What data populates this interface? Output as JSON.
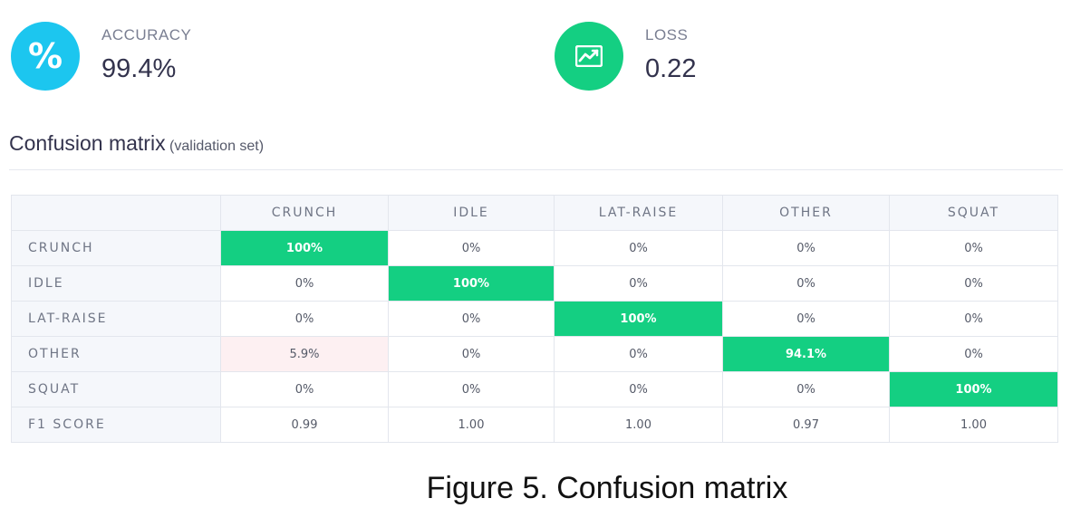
{
  "metrics": {
    "accuracy": {
      "label": "ACCURACY",
      "value": "99.4%",
      "icon": "percent-icon",
      "color": "#1cc6ef"
    },
    "loss": {
      "label": "LOSS",
      "value": "0.22",
      "icon": "chart-trend-icon",
      "color": "#14cf82"
    }
  },
  "confusion": {
    "title": "Confusion matrix",
    "subtitle": "(validation set)",
    "columns": [
      "CRUNCH",
      "IDLE",
      "LAT-RAISE",
      "OTHER",
      "SQUAT"
    ],
    "rows": [
      {
        "label": "CRUNCH",
        "cells": [
          "100%",
          "0%",
          "0%",
          "0%",
          "0%"
        ]
      },
      {
        "label": "IDLE",
        "cells": [
          "0%",
          "100%",
          "0%",
          "0%",
          "0%"
        ]
      },
      {
        "label": "LAT-RAISE",
        "cells": [
          "0%",
          "0%",
          "100%",
          "0%",
          "0%"
        ]
      },
      {
        "label": "OTHER",
        "cells": [
          "5.9%",
          "0%",
          "0%",
          "94.1%",
          "0%"
        ]
      },
      {
        "label": "SQUAT",
        "cells": [
          "0%",
          "0%",
          "0%",
          "0%",
          "100%"
        ]
      }
    ],
    "f1": {
      "label": "F1 SCORE",
      "cells": [
        "0.99",
        "1.00",
        "1.00",
        "0.97",
        "1.00"
      ]
    },
    "highlight_color": "#14cf82",
    "error_color": "#fdf0f2"
  },
  "caption": "Figure 5. Confusion matrix"
}
